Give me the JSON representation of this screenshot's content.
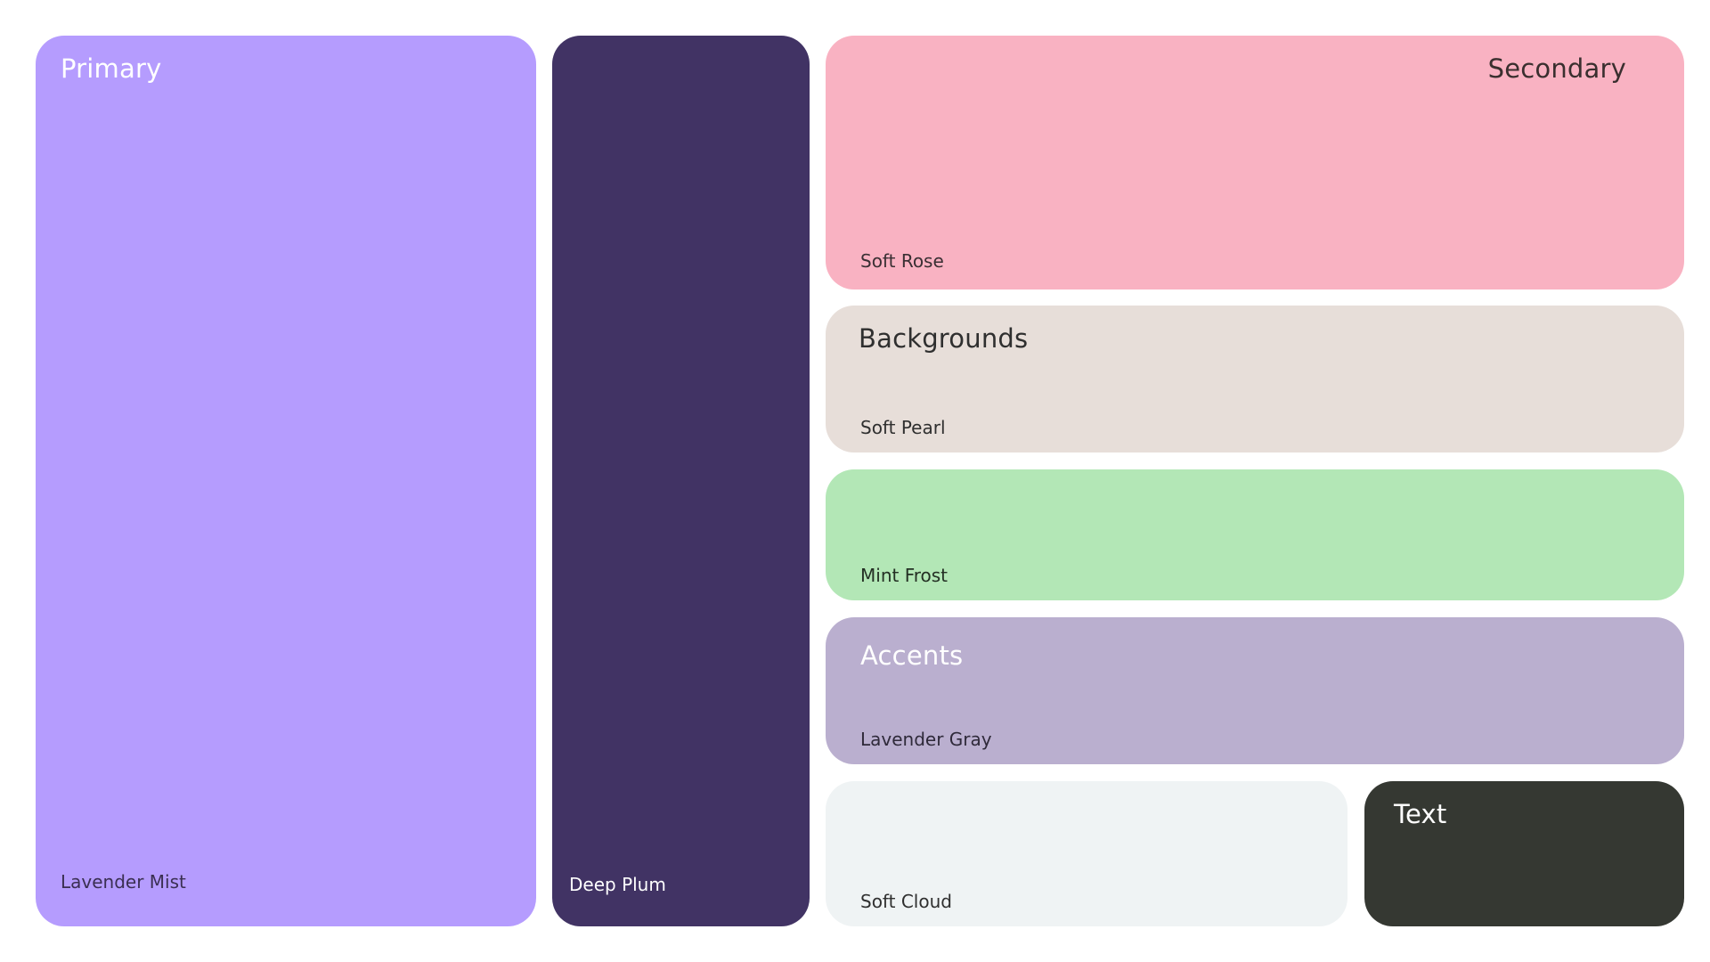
{
  "palette": {
    "primary": {
      "title": "Primary",
      "main": {
        "name": "Lavender Mist",
        "color": "#B59CFE"
      },
      "dark": {
        "name": "Deep Plum",
        "color": "#413364"
      }
    },
    "secondary": {
      "title": "Secondary",
      "main": {
        "name": "Soft Rose",
        "color": "#F9B2C2"
      }
    },
    "backgrounds": {
      "title": "Backgrounds",
      "pearl": {
        "name": "Soft Pearl",
        "color": "#E7DED9"
      },
      "mint": {
        "name": "Mint Frost",
        "color": "#B3E7B6"
      }
    },
    "accents": {
      "title": "Accents",
      "main": {
        "name": "Lavender Gray",
        "color": "#BAAFCF"
      }
    },
    "neutrals": {
      "cloud": {
        "name": "Soft Cloud",
        "color": "#EFF3F4"
      }
    },
    "text": {
      "title": "Text",
      "main": {
        "color": "#353832"
      }
    }
  }
}
